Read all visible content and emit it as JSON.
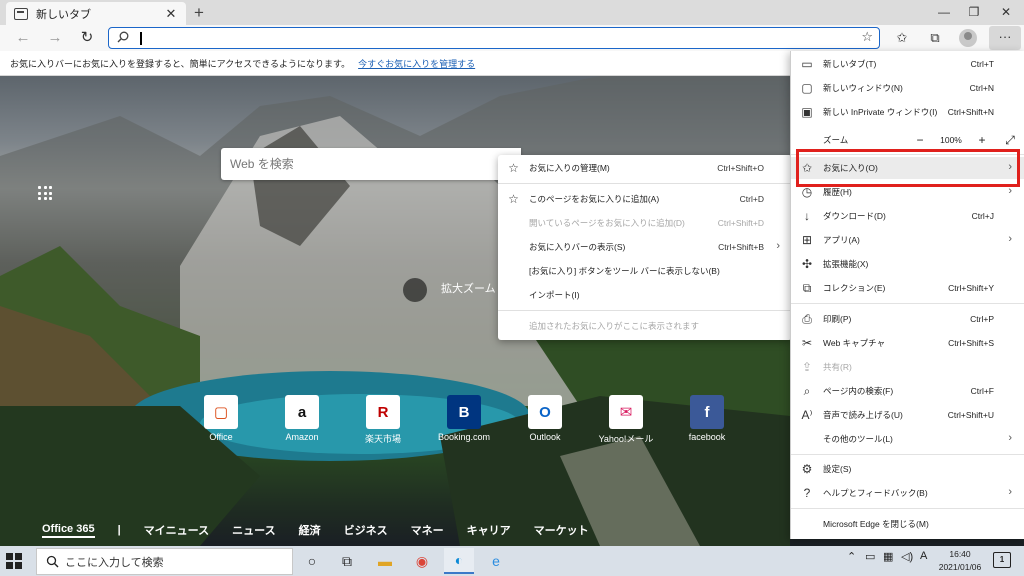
{
  "browser": {
    "tab_title": "新しいタブ",
    "new_tab_symbol": "+",
    "win_minimize": "—",
    "win_restore": "❐",
    "win_close": "✕",
    "address_value": "",
    "favorites_bar_message": "お気に入りバーにお気に入りを登録すると、簡単にアクセスできるようになります。",
    "favorites_bar_link": "今すぐお気に入りを管理する"
  },
  "newtab": {
    "search_placeholder": "Web を検索",
    "zoom_label": "拡大ズーム",
    "tiles": [
      {
        "label": "Office",
        "glyph": "▢",
        "color": "#d83b01"
      },
      {
        "label": "Amazon",
        "glyph": "a",
        "color": "#111111"
      },
      {
        "label": "楽天市場",
        "glyph": "R",
        "color": "#bf0000"
      },
      {
        "label": "Booking.com",
        "glyph": "B",
        "color": "#003580"
      },
      {
        "label": "Outlook",
        "glyph": "O",
        "color": "#0a64c8"
      },
      {
        "label": "Yahoo!メール",
        "glyph": "✉",
        "color": "#d81b60"
      },
      {
        "label": "facebook",
        "glyph": "f",
        "color": "#3b5998"
      }
    ],
    "nav": [
      "Office 365",
      "|",
      "マイニュース",
      "ニュース",
      "経済",
      "ビジネス",
      "マネー",
      "キャリア",
      "マーケット"
    ]
  },
  "favorites_submenu": {
    "items": [
      {
        "label": "お気に入りの管理(M)",
        "shortcut": "Ctrl+Shift+O",
        "icon": "☆"
      },
      {
        "label": "このページをお気に入りに追加(A)",
        "shortcut": "Ctrl+D",
        "icon": "☆"
      },
      {
        "label": "開いているページをお気に入りに追加(D)",
        "shortcut": "Ctrl+Shift+D",
        "icon": ""
      },
      {
        "label": "お気に入りバーの表示(S)",
        "shortcut": "Ctrl+Shift+B",
        "icon": ""
      },
      {
        "label": "[お気に入り] ボタンをツール バーに表示しない(B)",
        "shortcut": "",
        "icon": ""
      },
      {
        "label": "インポート(I)",
        "shortcut": "",
        "icon": ""
      },
      {
        "label": "追加されたお気に入りがここに表示されます",
        "shortcut": "",
        "icon": ""
      }
    ]
  },
  "main_menu": {
    "new_tab": {
      "label": "新しいタブ(T)",
      "shortcut": "Ctrl+T"
    },
    "new_window": {
      "label": "新しいウィンドウ(N)",
      "shortcut": "Ctrl+N"
    },
    "new_inprivate": {
      "label": "新しい InPrivate ウィンドウ(I)",
      "shortcut": "Ctrl+Shift+N"
    },
    "zoom": {
      "label": "ズーム",
      "minus": "−",
      "value": "100%",
      "plus": "+",
      "fullscreen": "⤢"
    },
    "favorites": {
      "label": "お気に入り(O)"
    },
    "history": {
      "label": "履歴(H)"
    },
    "downloads": {
      "label": "ダウンロード(D)",
      "shortcut": "Ctrl+J"
    },
    "apps": {
      "label": "アプリ(A)"
    },
    "extensions": {
      "label": "拡張機能(X)"
    },
    "collections": {
      "label": "コレクション(E)",
      "shortcut": "Ctrl+Shift+Y"
    },
    "print": {
      "label": "印刷(P)",
      "shortcut": "Ctrl+P"
    },
    "web_capture": {
      "label": "Web キャプチャ",
      "shortcut": "Ctrl+Shift+S"
    },
    "share": {
      "label": "共有(R)"
    },
    "find": {
      "label": "ページ内の検索(F)",
      "shortcut": "Ctrl+F"
    },
    "read_aloud": {
      "label": "音声で読み上げる(U)",
      "shortcut": "Ctrl+Shift+U"
    },
    "more_tools": {
      "label": "その他のツール(L)"
    },
    "settings": {
      "label": "設定(S)"
    },
    "help": {
      "label": "ヘルプとフィードバック(B)"
    },
    "close_edge": {
      "label": "Microsoft Edge を閉じる(M)"
    }
  },
  "taskbar": {
    "search_placeholder": "ここに入力して検索",
    "time": "16:40",
    "date": "2021/01/06",
    "ime": "A",
    "notif_count": "1"
  }
}
